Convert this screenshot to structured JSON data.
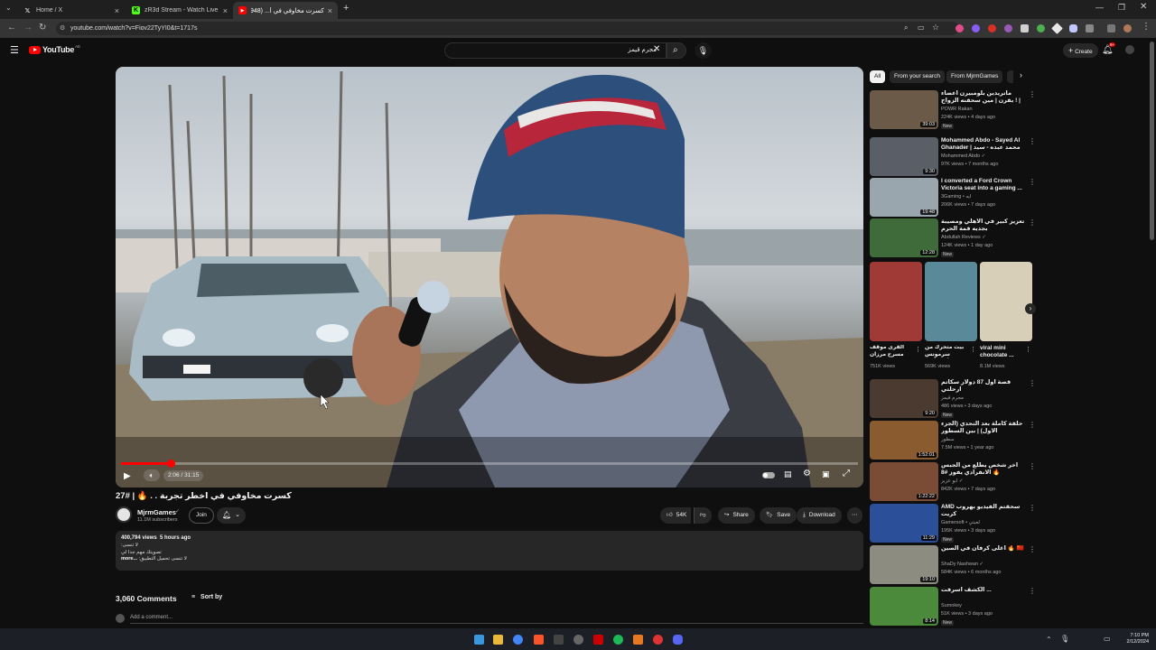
{
  "browser": {
    "tabs": [
      {
        "title": "Home / X",
        "icon": "x-logo-icon"
      },
      {
        "title": "zR3d Stream - Watch Live on K",
        "icon": "kick-logo-icon"
      },
      {
        "title": "كسرت مخاوفي في أ... (948)",
        "icon": "youtube-logo-icon"
      }
    ],
    "url": "youtube.com/watch?v=Fiov22TyYI0&t=1717s"
  },
  "header": {
    "logo": "YouTube",
    "region": "AE",
    "search_value": "مجرم قيمز",
    "create_label": "Create",
    "notif_badge": "9+"
  },
  "player": {
    "time_current": "2:06",
    "time_separator": "/",
    "time_total": "31:15",
    "progress": 0.067
  },
  "video": {
    "title": "كسرت مخاوفي في اخطر تجربة . . 🔥 | #27",
    "channel": "MjrmGames",
    "subscribers": "11.1M subscribers",
    "join_label": "Join",
    "likes": "54K",
    "share_label": "Share",
    "save_label": "Save",
    "download_label": "Download"
  },
  "description": {
    "views": "400,794 views",
    "age": "5 hours ago",
    "lines": [
      "لا تنسى:",
      "تصويتك مهم جدا لي",
      "لا تنسى تحميل التطبيق:"
    ],
    "more_label": "...more"
  },
  "comments": {
    "count_label": "3,060 Comments",
    "sort_label": "Sort by",
    "add_placeholder": "Add a comment..."
  },
  "chips": [
    "All",
    "From your search",
    "From MjrmGames"
  ],
  "recommendations": [
    {
      "title": "ماتريدين بلومبيرن اعضاء بقرن | مين سحقنه الزواج ! |",
      "channel": "POWR Rakan",
      "meta": "224K views • 4 days ago",
      "duration": "39:03",
      "badge": "New",
      "thumb": "#6b5a48"
    },
    {
      "title": "Mohammed Abdo - Sayed Al Ghanader | محمد عبده - سيد الغنادير",
      "channel": "Mohammed Abdo ✓",
      "meta": "97K views • 7 months ago",
      "duration": "9:30",
      "badge": "",
      "thumb": "#5a5e66"
    },
    {
      "title": "I converted a Ford Crown Victoria seat into a gaming ...",
      "channel": "3Gaming • ايه",
      "meta": "206K views • 7 days ago",
      "duration": "19:48",
      "badge": "",
      "thumb": "#9aa6ad"
    },
    {
      "title": "تعزيز كبير في الأهلي ومصيبة بجديه قمة الحرم",
      "channel": "Abdullah Reviews ✓",
      "meta": "124K views • 1 day ago",
      "duration": "12:28",
      "badge": "New",
      "thumb": "#3f6b3a"
    },
    {
      "title": "قصة أول 87 دولار سكاتم ارحلتي",
      "channel": "مجرم قيمز",
      "meta": "486 views • 3 days ago",
      "duration": "9:20",
      "badge": "New",
      "thumb": "#4a3a30"
    },
    {
      "title": "حلقة كاملة بعد التحدي (الجزء الاول) | بين السطور",
      "channel": "سطور",
      "meta": "7.5M views • 1 year ago",
      "duration": "1:52:01",
      "badge": "",
      "thumb": "#8a5b2e"
    },
    {
      "title": "آخر شخص يطلع من الجبس الانفرادي يفوز #8 🔥",
      "channel": "ابو عزيز ✓",
      "meta": "842K views • 7 days ago",
      "duration": "1:22:22",
      "badge": "",
      "thumb": "#7a4c36"
    },
    {
      "title": "AMD سحقتم الفيديو بهروب كريت",
      "channel": "Gamersoft • لعبتي",
      "meta": "195K views • 3 days ago",
      "duration": "11:29",
      "badge": "New",
      "thumb": "#2c4f9a"
    },
    {
      "title": "اغلى كرفان في الصين 🔥 🇨🇳",
      "channel": "ShaDy Nashwan ✓",
      "meta": "584K views • 6 months ago",
      "duration": "19:10",
      "badge": "",
      "thumb": "#8c8d80"
    },
    {
      "title": "الكشف اسرفت ...",
      "channel": "Sumokey",
      "meta": "51K views • 3 days ago",
      "duration": "8:14",
      "badge": "New",
      "thumb": "#4a8a3a"
    }
  ],
  "shorts": [
    {
      "title": "القرى موقف مسرح مرزان مجرم قيمز",
      "views": "751K views",
      "thumb": "#a03a36"
    },
    {
      "title": "بيت متحرك من سرمونس تامسيان...",
      "views": "569K views",
      "thumb": "#5a8a9a"
    },
    {
      "title": "viral mini chocolate ...",
      "views": "8.1M views",
      "thumb": "#d8cfb8"
    }
  ],
  "taskbar": {
    "time": "7:10 PM",
    "date": "2/12/2024"
  }
}
